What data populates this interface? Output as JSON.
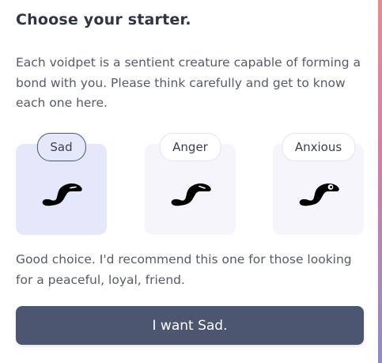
{
  "dialog": {
    "title": "Choose your starter.",
    "intro": "Each voidpet is a sentient creature capable of forming a bond with you. Please think carefully and get to know each one here.",
    "choices": [
      {
        "label": "Sad",
        "selected": true,
        "icon": "voidpet-sad-icon"
      },
      {
        "label": "Anger",
        "selected": false,
        "icon": "voidpet-anger-icon"
      },
      {
        "label": "Anxious",
        "selected": false,
        "icon": "voidpet-anxious-icon"
      }
    ],
    "verdict": "Good choice. I'd recommend this one for those looking for a peaceful, loyal, friend.",
    "confirm_label": "I want Sad."
  },
  "colors": {
    "accent": "#4d5670",
    "selected_bg": "#e5e7fb",
    "card_bg": "#f6f5fc",
    "text": "#555b6a",
    "title": "#2f3542"
  }
}
